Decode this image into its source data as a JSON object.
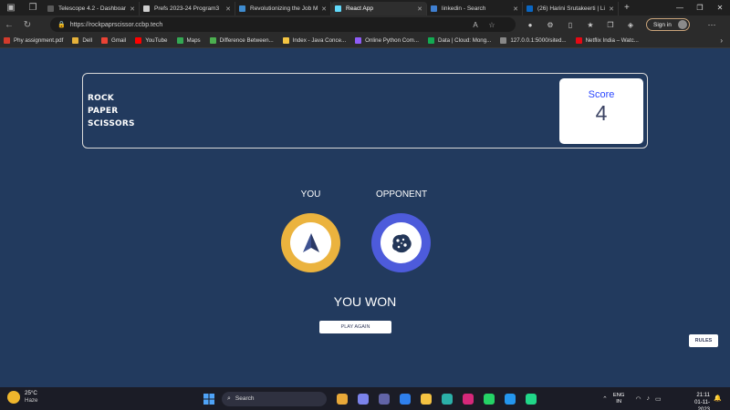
{
  "browser": {
    "tabs": [
      {
        "title": "Telescope 4.2 - Dashboard",
        "color": "#5a5a5a",
        "active": false
      },
      {
        "title": "Prefs 2023-24 Program3",
        "color": "#cfcfcf",
        "active": false
      },
      {
        "title": "Revolutionizing the Job M",
        "color": "#3f8cd0",
        "active": false
      },
      {
        "title": "React App",
        "color": "#61dafb",
        "active": true
      },
      {
        "title": "linkedin - Search",
        "color": "#3f7fd0",
        "active": false
      },
      {
        "title": "(26) Harini Srutakeerti | Li",
        "color": "#0a66c2",
        "active": false
      }
    ],
    "url": "https://rockpaprscissor.ccbp.tech",
    "sign_in_label": "Sign in",
    "bookmarks": [
      {
        "label": "Phy assignment.pdf",
        "color": "#d33b2c"
      },
      {
        "label": "Dell",
        "color": "#e5b13a"
      },
      {
        "label": "Gmail",
        "color": "#ea4335"
      },
      {
        "label": "YouTube",
        "color": "#ff0000"
      },
      {
        "label": "Maps",
        "color": "#34a853"
      },
      {
        "label": "Difference Between...",
        "color": "#4caf50"
      },
      {
        "label": "Index - Java Conce...",
        "color": "#f4c542"
      },
      {
        "label": "Online Python Com...",
        "color": "#8e5cf7"
      },
      {
        "label": "Data | Cloud: Mong...",
        "color": "#13aa52"
      },
      {
        "label": "127.0.0.1:5000/sited...",
        "color": "#888888"
      },
      {
        "label": "Netflix India – Watc...",
        "color": "#e50914"
      }
    ]
  },
  "game": {
    "title_lines": [
      "ROCK",
      "PAPER",
      "SCISSORS"
    ],
    "score_label": "Score",
    "score_value": "4",
    "you_label": "YOU",
    "opponent_label": "OPPONENT",
    "you_choice": "paper-plane-icon",
    "opponent_choice": "cookie-icon",
    "you_ring_color": "#ebb33e",
    "opponent_ring_color": "#4d5bdb",
    "result_text": "YOU WON",
    "play_again_label": "PLAY AGAIN",
    "rules_label": "RULES"
  },
  "taskbar": {
    "temperature": "25°C",
    "weather_desc": "Haze",
    "search_label": "Search",
    "apps": [
      {
        "name": "start-icon",
        "color": "#4fa3f7"
      },
      {
        "name": "widgets-icon",
        "color": "#e8a838"
      },
      {
        "name": "teams-icon",
        "color": "#7b83eb"
      },
      {
        "name": "meet-icon",
        "color": "#6264a7"
      },
      {
        "name": "vscode-icon",
        "color": "#2f80ed"
      },
      {
        "name": "folder-icon",
        "color": "#f5c242"
      },
      {
        "name": "edge-icon",
        "color": "#2bb0a8"
      },
      {
        "name": "instagram-icon",
        "color": "#d6287a"
      },
      {
        "name": "whatsapp-icon",
        "color": "#25d366"
      },
      {
        "name": "docker-icon",
        "color": "#2496ed"
      },
      {
        "name": "pycharm-icon",
        "color": "#21d789"
      }
    ],
    "language_1": "ENG",
    "language_2": "IN",
    "time": "21:11",
    "date": "01-11-2023"
  }
}
